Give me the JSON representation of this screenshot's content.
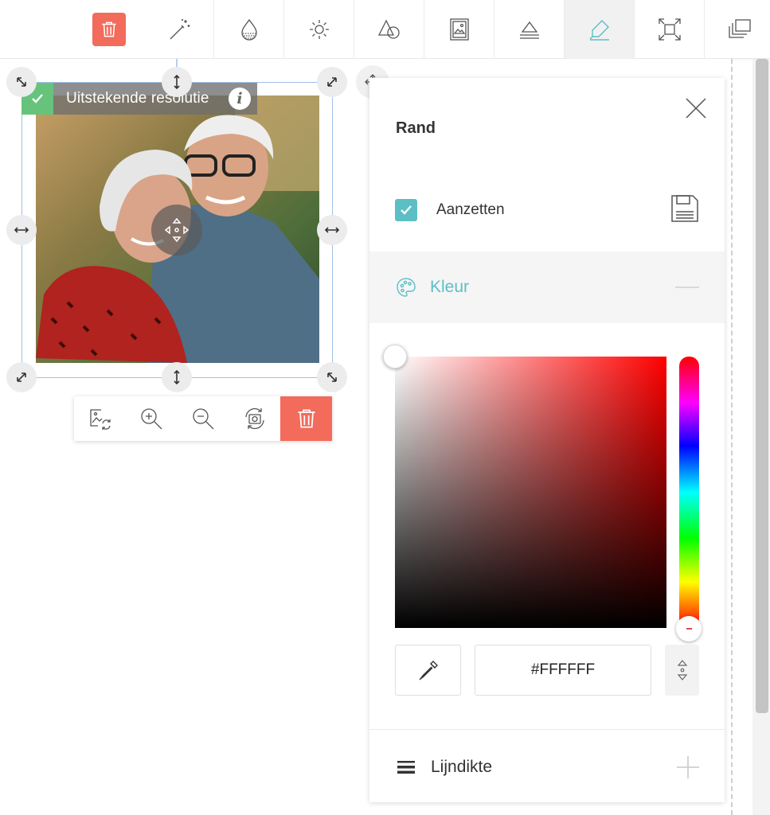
{
  "toolbar": {
    "items": [
      {
        "name": "delete",
        "icon": "trash-icon"
      },
      {
        "name": "magic",
        "icon": "magic-wand-icon"
      },
      {
        "name": "transparency",
        "icon": "transparency-drop-icon"
      },
      {
        "name": "brightness",
        "icon": "sun-icon"
      },
      {
        "name": "shapes",
        "icon": "shapes-icon"
      },
      {
        "name": "frame",
        "icon": "picture-frame-icon"
      },
      {
        "name": "align",
        "icon": "align-layers-icon"
      },
      {
        "name": "border",
        "icon": "highlighter-icon"
      },
      {
        "name": "fullscreen",
        "icon": "fit-frame-icon"
      },
      {
        "name": "layers",
        "icon": "layers-icon"
      }
    ],
    "active": "border"
  },
  "photo": {
    "resolution_label": "Uitstekende resolutie",
    "info_glyph": "i"
  },
  "image_toolbar": {
    "buttons": [
      {
        "name": "replace-image",
        "icon": "image-replace-icon"
      },
      {
        "name": "zoom-in",
        "icon": "zoom-in-icon"
      },
      {
        "name": "zoom-out",
        "icon": "zoom-out-icon"
      },
      {
        "name": "rotate",
        "icon": "rotate-camera-icon"
      },
      {
        "name": "delete",
        "icon": "trash-icon"
      }
    ]
  },
  "panel": {
    "title": "Rand",
    "enable_label": "Aanzetten",
    "enabled": true,
    "color_section": {
      "label": "Kleur",
      "hex_value": "#FFFFFF",
      "hue_color": "#ff0000"
    },
    "line_section": {
      "label": "Lijndikte"
    }
  },
  "colors": {
    "accent": "#5bbfc5",
    "danger": "#f26b5b",
    "success": "#67c37b"
  }
}
